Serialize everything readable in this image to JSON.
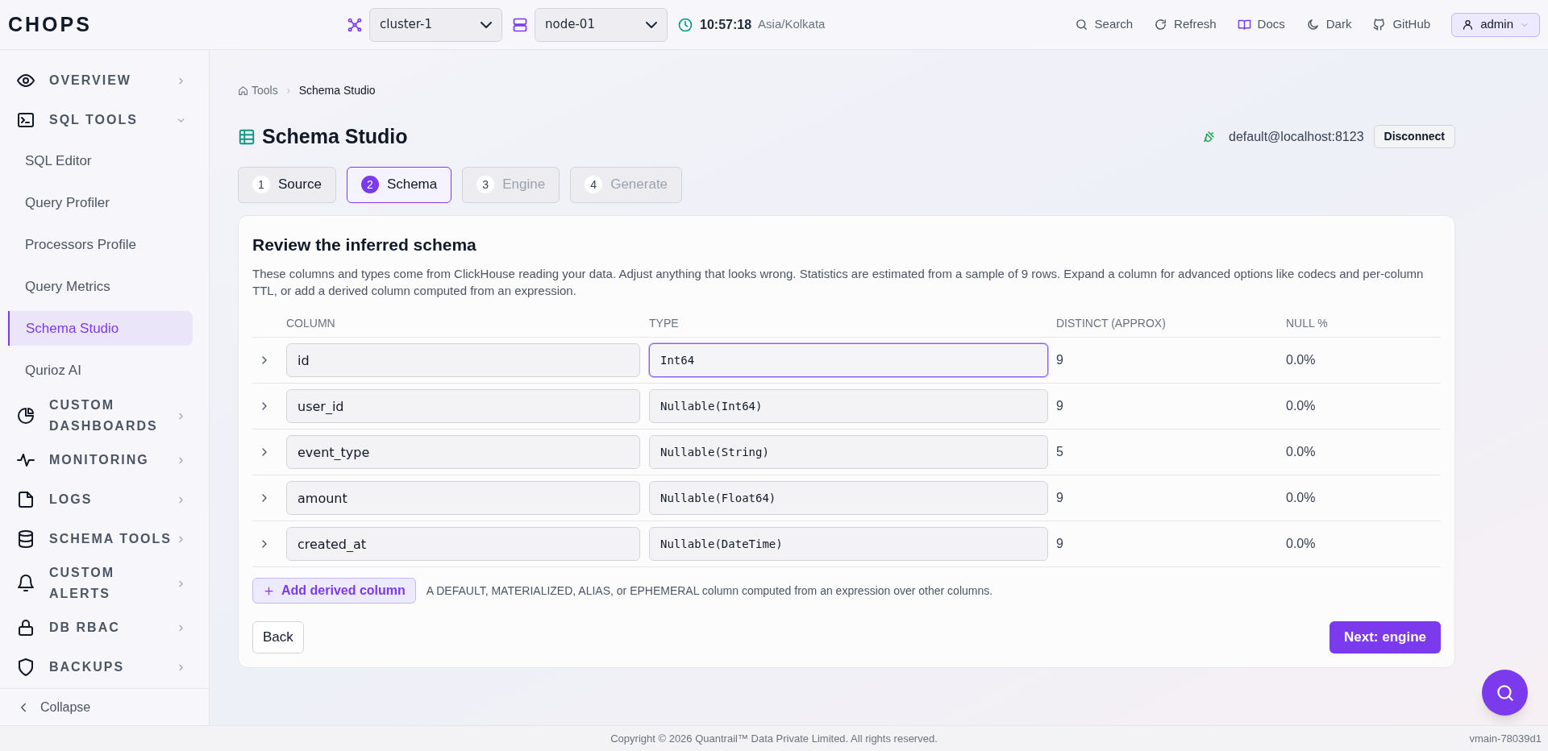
{
  "header": {
    "logo": "CHOPS",
    "cluster": "cluster-1",
    "node": "node-01",
    "time": "10:57:18",
    "timezone": "Asia/Kolkata",
    "actions": [
      {
        "label": "Search"
      },
      {
        "label": "Refresh"
      },
      {
        "label": "Docs"
      },
      {
        "label": "Dark"
      },
      {
        "label": "GitHub"
      }
    ],
    "user": "admin"
  },
  "sidebar": {
    "items": [
      {
        "kind": "section",
        "label": "OVERVIEW",
        "expanded": false
      },
      {
        "kind": "section",
        "label": "SQL TOOLS",
        "expanded": true,
        "children": [
          {
            "label": "SQL Editor",
            "selected": false
          },
          {
            "label": "Query Profiler",
            "selected": false
          },
          {
            "label": "Processors Profile",
            "selected": false
          },
          {
            "label": "Query Metrics",
            "selected": false
          },
          {
            "label": "Schema Studio",
            "selected": true
          },
          {
            "label": "Qurioz AI",
            "selected": false
          }
        ]
      },
      {
        "kind": "section",
        "label": "CUSTOM DASHBOARDS",
        "expanded": false
      },
      {
        "kind": "section",
        "label": "MONITORING",
        "expanded": false
      },
      {
        "kind": "section",
        "label": "LOGS",
        "expanded": false
      },
      {
        "kind": "section",
        "label": "SCHEMA TOOLS",
        "expanded": false
      },
      {
        "kind": "section",
        "label": "CUSTOM ALERTS",
        "expanded": false
      },
      {
        "kind": "section",
        "label": "DB RBAC",
        "expanded": false
      },
      {
        "kind": "section",
        "label": "BACKUPS",
        "expanded": false
      }
    ],
    "collapse": "Collapse"
  },
  "breadcrumb": [
    "Tools",
    "Schema Studio"
  ],
  "page_title": "Schema Studio",
  "connection": {
    "label": "default@localhost:8123",
    "button": "Disconnect"
  },
  "tabs": [
    {
      "number": "1",
      "label": "Source",
      "selected": false,
      "disabled": false
    },
    {
      "number": "2",
      "label": "Schema",
      "selected": true,
      "disabled": false
    },
    {
      "number": "3",
      "label": "Engine",
      "selected": false,
      "disabled": true
    },
    {
      "number": "4",
      "label": "Generate",
      "selected": false,
      "disabled": true
    }
  ],
  "card": {
    "title": "Review the inferred schema",
    "description": "These columns and types come from ClickHouse reading your data. Adjust anything that looks wrong. Statistics are estimated from a sample of 9 rows. Expand a column for advanced options like codecs and per-column TTL, or add a derived column computed from an expression.",
    "table": {
      "columns": [
        "COLUMN",
        "TYPE",
        "DISTINCT (APPROX)",
        "NULL %"
      ],
      "rows": [
        {
          "name": "id",
          "type": "Int64",
          "distinct": "9",
          "null_pct": "0.0%",
          "type_focused": true
        },
        {
          "name": "user_id",
          "type": "Nullable(Int64)",
          "distinct": "9",
          "null_pct": "0.0%",
          "type_focused": false
        },
        {
          "name": "event_type",
          "type": "Nullable(String)",
          "distinct": "5",
          "null_pct": "0.0%",
          "type_focused": false
        },
        {
          "name": "amount",
          "type": "Nullable(Float64)",
          "distinct": "9",
          "null_pct": "0.0%",
          "type_focused": false
        },
        {
          "name": "created_at",
          "type": "Nullable(DateTime)",
          "distinct": "9",
          "null_pct": "0.0%",
          "type_focused": false
        }
      ]
    },
    "add_button": "Add derived column",
    "add_hint": "A DEFAULT, MATERIALIZED, ALIAS, or EPHEMERAL column computed from an expression over other columns.",
    "back": "Back",
    "next": "Next: engine"
  },
  "footer": {
    "copyright": "Copyright © 2026 Quantrail™ Data Private Limited. All rights reserved.",
    "version": "vmain-78039d1"
  }
}
